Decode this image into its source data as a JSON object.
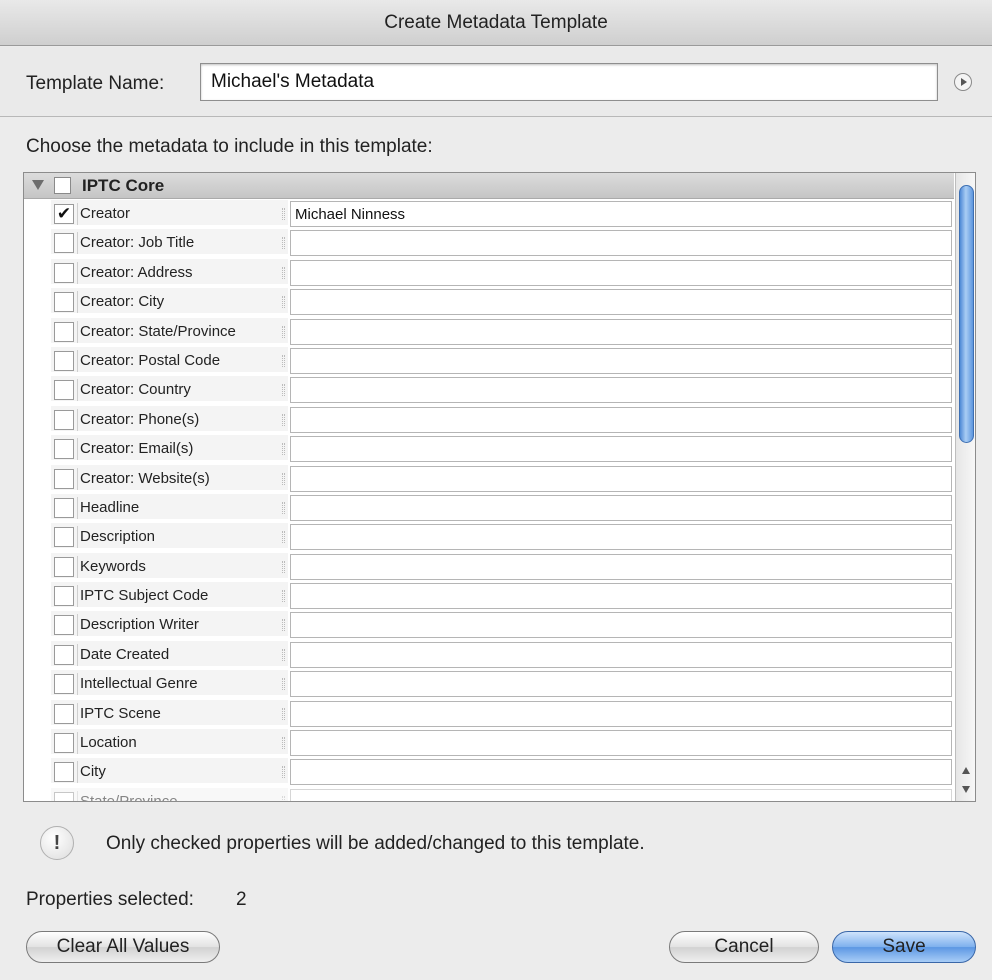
{
  "window": {
    "title": "Create Metadata Template"
  },
  "template_name": {
    "label": "Template Name:",
    "value": "Michael's Metadata"
  },
  "choose_label": "Choose the metadata to include in this template:",
  "group": {
    "label": "IPTC Core",
    "expanded": true
  },
  "rows": [
    {
      "label": "Creator",
      "checked": true,
      "value": "Michael Ninness"
    },
    {
      "label": "Creator: Job Title",
      "checked": false,
      "value": ""
    },
    {
      "label": "Creator: Address",
      "checked": false,
      "value": ""
    },
    {
      "label": "Creator: City",
      "checked": false,
      "value": ""
    },
    {
      "label": "Creator: State/Province",
      "checked": false,
      "value": ""
    },
    {
      "label": "Creator: Postal Code",
      "checked": false,
      "value": ""
    },
    {
      "label": "Creator: Country",
      "checked": false,
      "value": ""
    },
    {
      "label": "Creator: Phone(s)",
      "checked": false,
      "value": ""
    },
    {
      "label": "Creator: Email(s)",
      "checked": false,
      "value": ""
    },
    {
      "label": "Creator: Website(s)",
      "checked": false,
      "value": ""
    },
    {
      "label": "Headline",
      "checked": false,
      "value": ""
    },
    {
      "label": "Description",
      "checked": false,
      "value": ""
    },
    {
      "label": "Keywords",
      "checked": false,
      "value": ""
    },
    {
      "label": "IPTC Subject Code",
      "checked": false,
      "value": ""
    },
    {
      "label": "Description Writer",
      "checked": false,
      "value": ""
    },
    {
      "label": "Date Created",
      "checked": false,
      "value": ""
    },
    {
      "label": "Intellectual Genre",
      "checked": false,
      "value": ""
    },
    {
      "label": "IPTC Scene",
      "checked": false,
      "value": ""
    },
    {
      "label": "Location",
      "checked": false,
      "value": ""
    },
    {
      "label": "City",
      "checked": false,
      "value": ""
    },
    {
      "label": "State/Province",
      "checked": false,
      "value": ""
    }
  ],
  "info_message": "Only checked properties will be added/changed to this template.",
  "properties_selected": {
    "label": "Properties selected:",
    "count": "2"
  },
  "buttons": {
    "clear": "Clear All Values",
    "cancel": "Cancel",
    "save": "Save"
  },
  "colors": {
    "accent": "#5c97e3",
    "thumb": "#7eb0ee"
  }
}
